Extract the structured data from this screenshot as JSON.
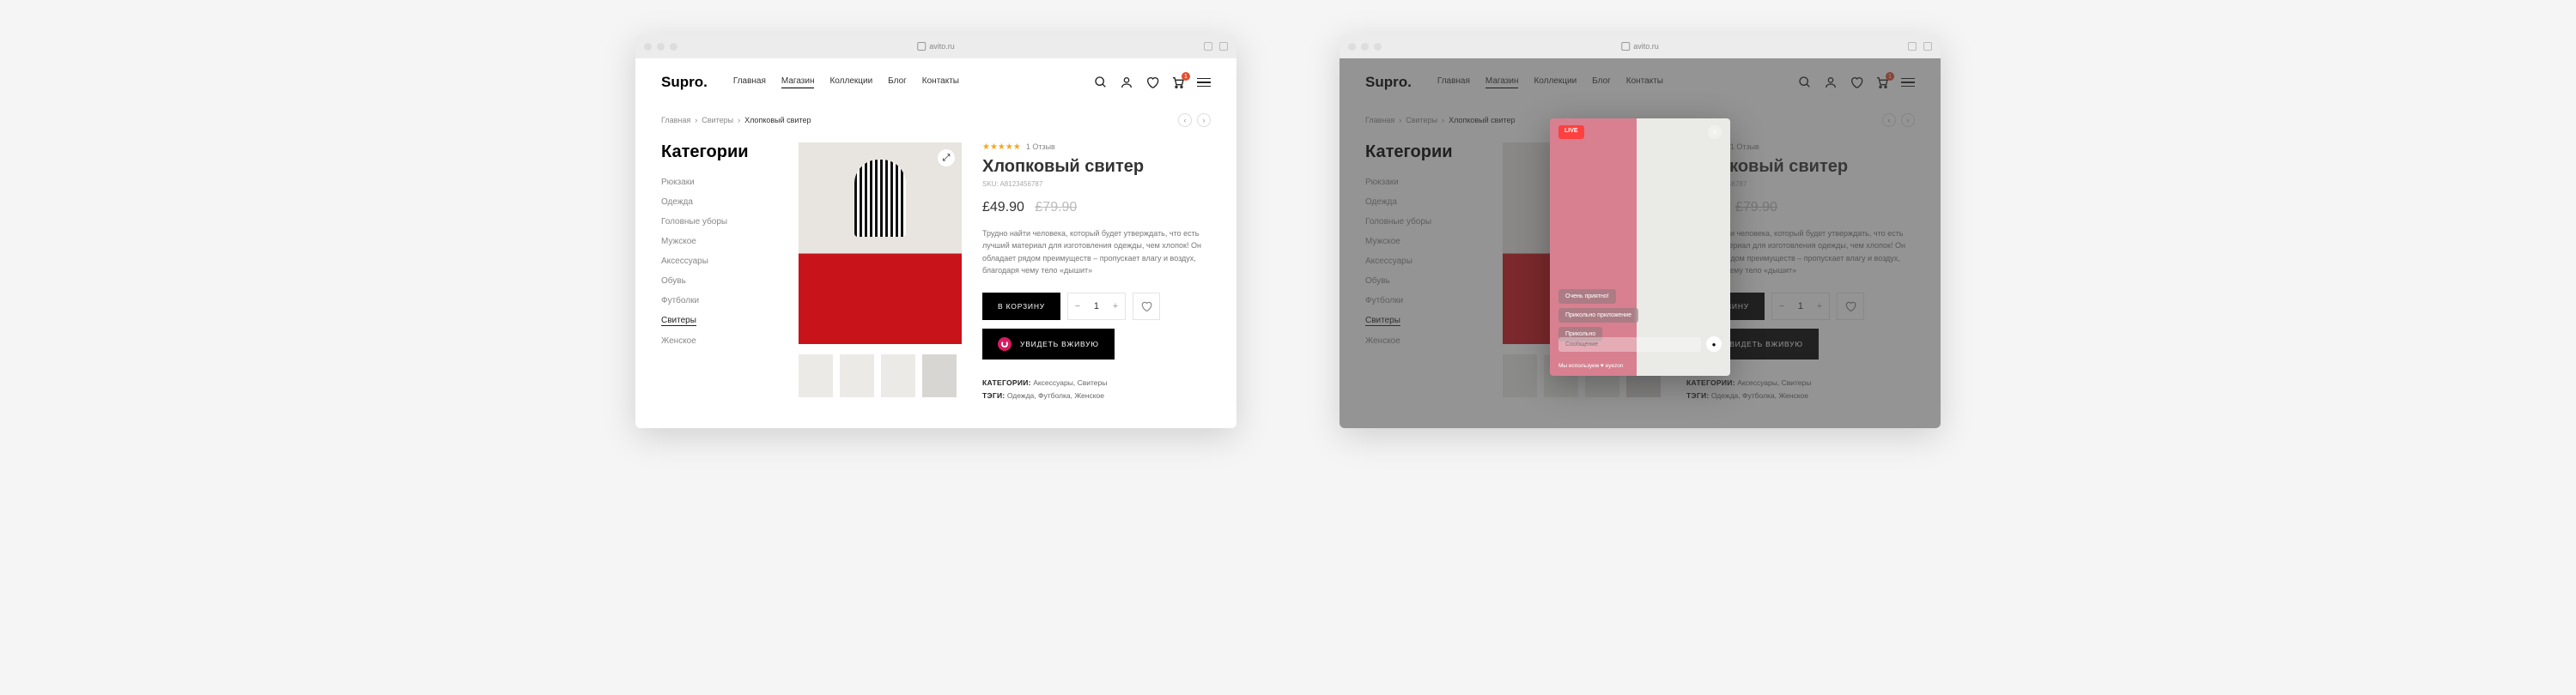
{
  "browser": {
    "url": "avito.ru"
  },
  "header": {
    "logo": "Supro.",
    "nav": [
      "Главная",
      "Магазин",
      "Коллекции",
      "Блог",
      "Контакты"
    ],
    "nav_active_index": 1,
    "cart_count": "1"
  },
  "breadcrumbs": [
    "Главная",
    "Свитеры",
    "Хлопковый свитер"
  ],
  "sidebar": {
    "title": "Категории",
    "items": [
      "Рюкзаки",
      "Одежда",
      "Головные уборы",
      "Мужское",
      "Аксессуары",
      "Обувь",
      "Футболки",
      "Свитеры",
      "Женское"
    ],
    "active_index": 7
  },
  "product": {
    "reviews": "1 Отзыв",
    "title": "Хлопковый свитер",
    "sku": "SKU: A8123456787",
    "price": "£49.90",
    "old_price": "£79.90",
    "description": "Трудно найти человека, который будет утверждать, что есть лучший материал для изготовления одежды, чем хлопок! Он обладает рядом преимуществ – пропускает влагу и воздух, благодаря чему тело «дышит»",
    "add_to_cart": "В КОРЗИНУ",
    "qty": "1",
    "see_live": "УВИДЕТЬ ВЖИВУЮ",
    "meta1_label": "КАТЕГОРИИ:",
    "meta1_val": "Аксессуары, Свитеры",
    "meta2_label": "ТЭГИ:",
    "meta2_val": "Одежда, Футболка, Женское"
  },
  "modal": {
    "live_label": "LIVE",
    "bubbles": [
      "Очень приятно!",
      "Прикольно приложение",
      "Прикольно"
    ],
    "msg_placeholder": "Сообщение",
    "brand": "Мы используем ♥ eyezon"
  }
}
